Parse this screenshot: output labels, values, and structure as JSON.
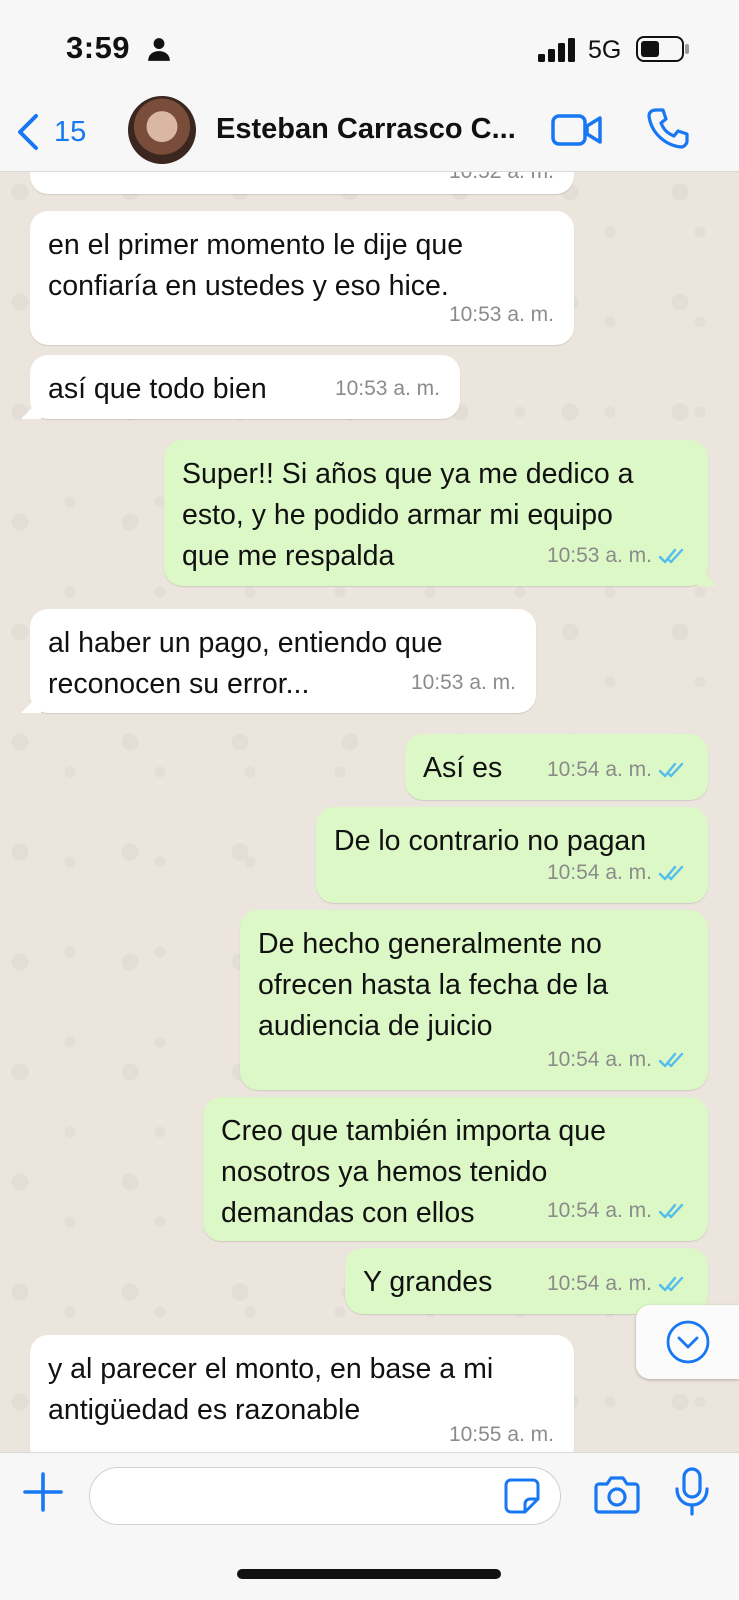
{
  "status_bar": {
    "time": "3:59",
    "network": "5G"
  },
  "header": {
    "back_count": "15",
    "contact_name": "Esteban Carrasco C..."
  },
  "messages": [
    {
      "dir": "in",
      "text": "",
      "time": "10:52 a. m."
    },
    {
      "dir": "in",
      "text": "en el primer momento le dije que\nconfiaría en ustedes y eso hice.",
      "time": "10:53 a. m."
    },
    {
      "dir": "in",
      "text": "así que todo bien",
      "time": "10:53 a. m."
    },
    {
      "dir": "out",
      "text": "Super!! Si años que ya me dedico a\nesto, y he podido armar mi equipo\nque me respalda",
      "time": "10:53 a. m."
    },
    {
      "dir": "in",
      "text": "al haber un pago, entiendo que\nreconocen su error...",
      "time": "10:53 a. m."
    },
    {
      "dir": "out",
      "text": "Así es",
      "time": "10:54 a. m."
    },
    {
      "dir": "out",
      "text": "De lo contrario no pagan",
      "time": "10:54 a. m."
    },
    {
      "dir": "out",
      "text": "De hecho generalmente no\nofrecen hasta la fecha de la\naudiencia de juicio",
      "time": "10:54 a. m."
    },
    {
      "dir": "out",
      "text": "Creo que también importa que\nnosotros ya hemos tenido\ndemandas con ellos",
      "time": "10:54 a. m."
    },
    {
      "dir": "out",
      "text": "Y grandes",
      "time": "10:54 a. m."
    },
    {
      "dir": "in",
      "text": "y al parecer el monto, en base a mi\nantigüedad es razonable",
      "time": "10:55 a. m."
    }
  ],
  "input": {
    "placeholder": ""
  },
  "colors": {
    "accent": "#1877f2",
    "outgoing_bubble": "#dcf8c6",
    "incoming_bubble": "#ffffff",
    "read_ticks": "#53bdeb"
  },
  "icons": [
    "person-icon",
    "signal-icon",
    "battery-icon",
    "chevron-left-icon",
    "video-call-icon",
    "phone-icon",
    "double-check-icon",
    "chevron-down-circle-icon",
    "plus-icon",
    "sticker-icon",
    "camera-icon",
    "microphone-icon"
  ]
}
